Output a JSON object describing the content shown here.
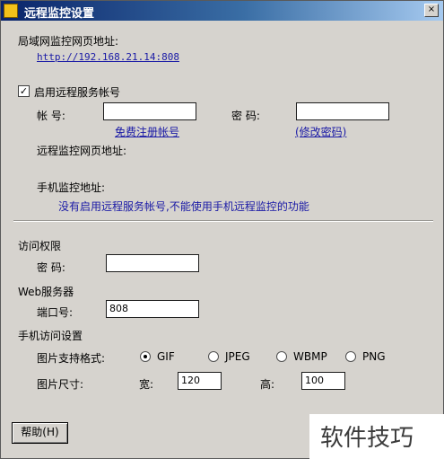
{
  "window": {
    "title": "远程监控设置",
    "close_label": "×"
  },
  "lan": {
    "label": "局域网监控网页地址:",
    "url": "http://192.168.21.14:808"
  },
  "remote_account": {
    "checkbox_label": "启用远程服务帐号",
    "checked": true,
    "check_mark": "✓",
    "account_label": "帐 号:",
    "account_value": "",
    "password_label": "密 码:",
    "password_value": "",
    "register_link": "免费注册帐号",
    "change_password_link": "(修改密码)",
    "remote_url_label": "远程监控网页地址:",
    "mobile_label": "手机监控地址:",
    "mobile_note": "没有启用远程服务帐号,不能使用手机远程监控的功能"
  },
  "access": {
    "section_label": "访问权限",
    "password_label": "密 码:",
    "password_value": ""
  },
  "web_server": {
    "section_label": "Web服务器",
    "port_label": "端口号:",
    "port_value": "808"
  },
  "mobile_access": {
    "section_label": "手机访问设置",
    "format_label": "图片支持格式:",
    "formats": [
      {
        "label": "GIF",
        "selected": true
      },
      {
        "label": "JPEG",
        "selected": false
      },
      {
        "label": "WBMP",
        "selected": false
      },
      {
        "label": "PNG",
        "selected": false
      }
    ],
    "size_label": "图片尺寸:",
    "width_label": "宽:",
    "width_value": "120",
    "height_label": "高:",
    "height_value": "100"
  },
  "footer": {
    "help_button": "帮助(H)"
  },
  "watermark": {
    "text": "软件技巧"
  }
}
